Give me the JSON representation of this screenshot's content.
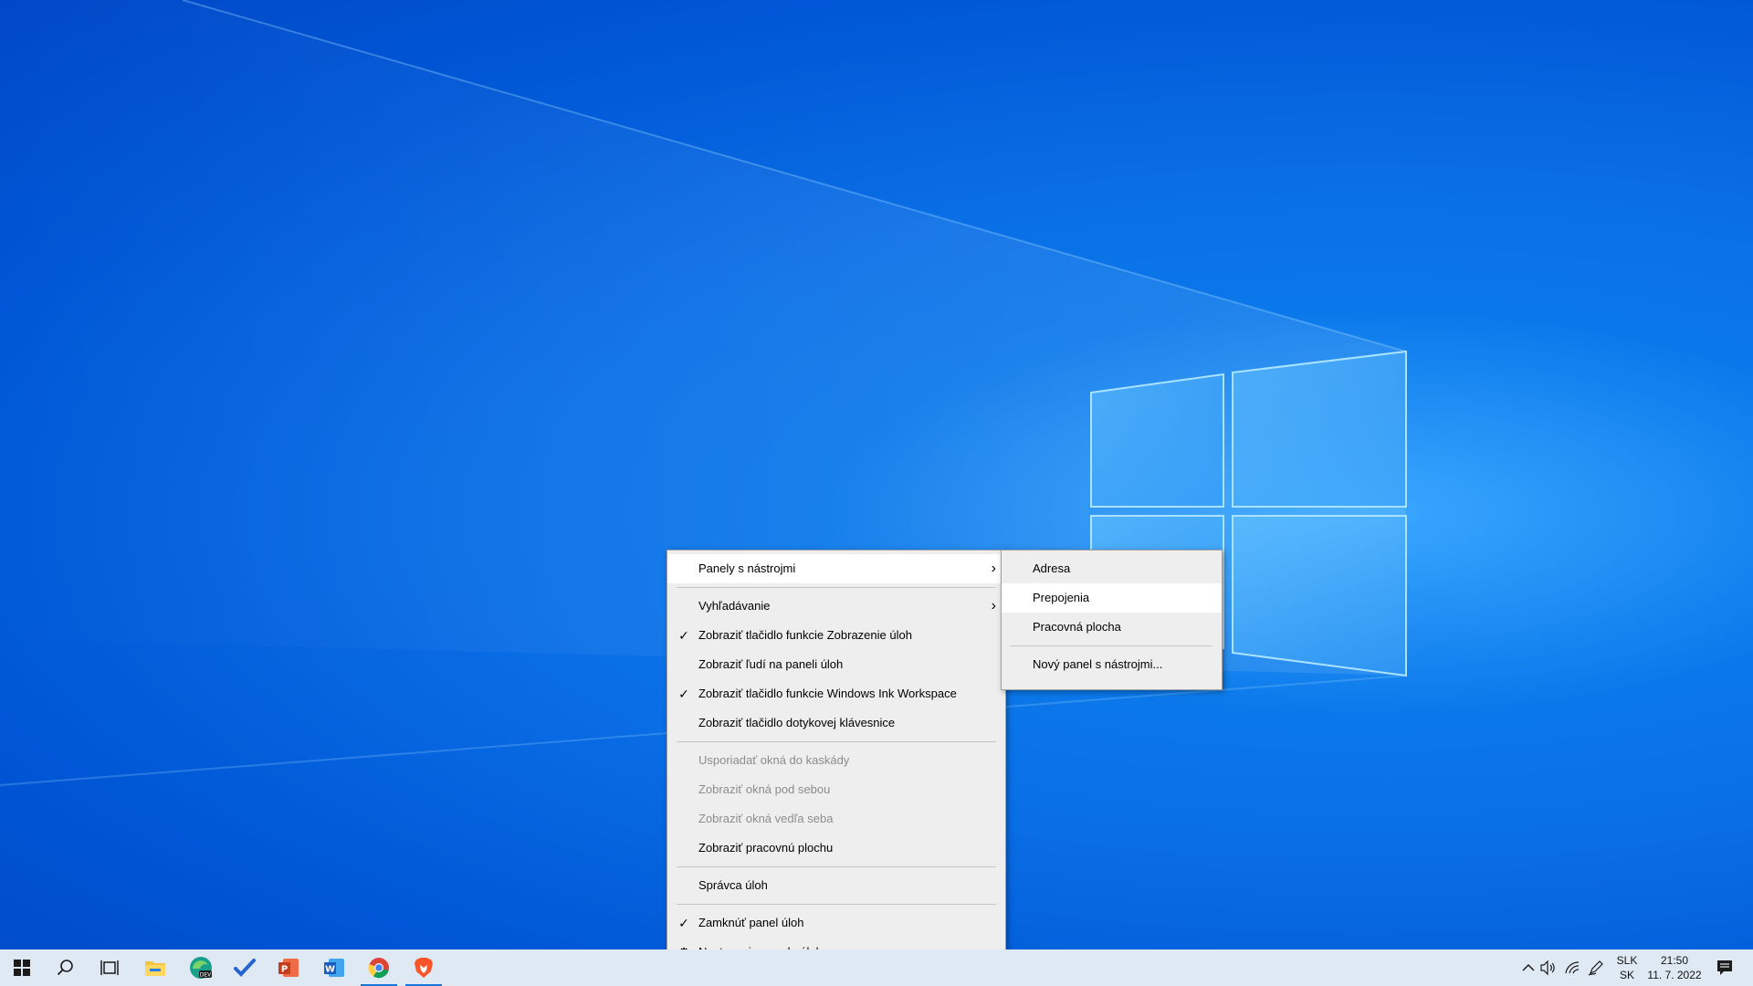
{
  "main_menu": {
    "items": [
      {
        "label": "Panely s nástrojmi",
        "checked": false,
        "submenu": true,
        "disabled": false
      },
      {
        "label": "Vyhľadávanie",
        "checked": false,
        "submenu": true,
        "disabled": false
      },
      {
        "label": "Zobraziť tlačidlo funkcie Zobrazenie úloh",
        "checked": true,
        "submenu": false,
        "disabled": false
      },
      {
        "label": "Zobraziť ľudí na paneli úloh",
        "checked": false,
        "submenu": false,
        "disabled": false
      },
      {
        "label": "Zobraziť tlačidlo funkcie Windows Ink Workspace",
        "checked": true,
        "submenu": false,
        "disabled": false
      },
      {
        "label": "Zobraziť tlačidlo dotykovej klávesnice",
        "checked": false,
        "submenu": false,
        "disabled": false
      },
      {
        "label": "Usporiadať okná do kaskády",
        "checked": false,
        "submenu": false,
        "disabled": true
      },
      {
        "label": "Zobraziť okná pod sebou",
        "checked": false,
        "submenu": false,
        "disabled": true
      },
      {
        "label": "Zobraziť okná vedľa seba",
        "checked": false,
        "submenu": false,
        "disabled": true
      },
      {
        "label": "Zobraziť pracovnú plochu",
        "checked": false,
        "submenu": false,
        "disabled": false
      },
      {
        "label": "Správca úloh",
        "checked": false,
        "submenu": false,
        "disabled": false
      },
      {
        "label": "Zamknúť panel úloh",
        "checked": true,
        "submenu": false,
        "disabled": false
      },
      {
        "label": "Nastavenia panela úloh",
        "checked": false,
        "submenu": false,
        "disabled": false,
        "icon": "gear-icon"
      }
    ]
  },
  "sub_menu": {
    "items": [
      {
        "label": "Adresa"
      },
      {
        "label": "Prepojenia"
      },
      {
        "label": "Pracovná plocha"
      },
      {
        "label": "Nový panel s nástrojmi..."
      }
    ]
  },
  "taskbar": {
    "icons": [
      "windows-start-icon",
      "search-icon",
      "task-view-icon",
      "file-explorer-icon",
      "edge-dev-icon",
      "todo-icon",
      "powerpoint-icon",
      "word-icon",
      "chrome-icon",
      "brave-icon"
    ],
    "tray": {
      "lang_top": "SLK",
      "lang_bottom": "SK",
      "time": "21:50",
      "date": "11. 7. 2022"
    }
  },
  "colors": {
    "accent": "#1a73d9",
    "menu_bg": "#eeeeee",
    "taskbar_bg": "#dfe9f3"
  }
}
